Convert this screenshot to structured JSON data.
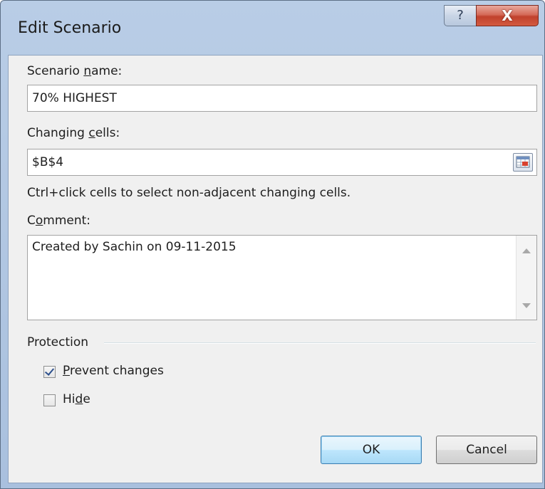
{
  "window": {
    "title": "Edit Scenario",
    "help_glyph": "?",
    "close_glyph": "X"
  },
  "scenario_name": {
    "label_pre": "Scenario ",
    "label_ul": "n",
    "label_post": "ame:",
    "value": "70% HIGHEST"
  },
  "changing_cells": {
    "label_pre": "Changing ",
    "label_ul": "c",
    "label_post": "ells:",
    "value": "$B$4",
    "ref_button_icon": "range-select-icon"
  },
  "hint": "Ctrl+click cells to select non-adjacent changing cells.",
  "comment": {
    "label_pre": "C",
    "label_ul": "o",
    "label_post": "mment:",
    "value": "Created by Sachin on 09-11-2015"
  },
  "protection": {
    "heading": "Protection",
    "prevent_changes": {
      "label_ul": "P",
      "label_post": "revent changes",
      "checked": true
    },
    "hide": {
      "label_pre": "Hi",
      "label_ul": "d",
      "label_post": "e",
      "checked": false
    }
  },
  "buttons": {
    "ok": "OK",
    "cancel": "Cancel"
  },
  "colors": {
    "title_bar": "#b9cde6",
    "close_button": "#c0412c",
    "default_button_border": "#3c7fb1"
  }
}
